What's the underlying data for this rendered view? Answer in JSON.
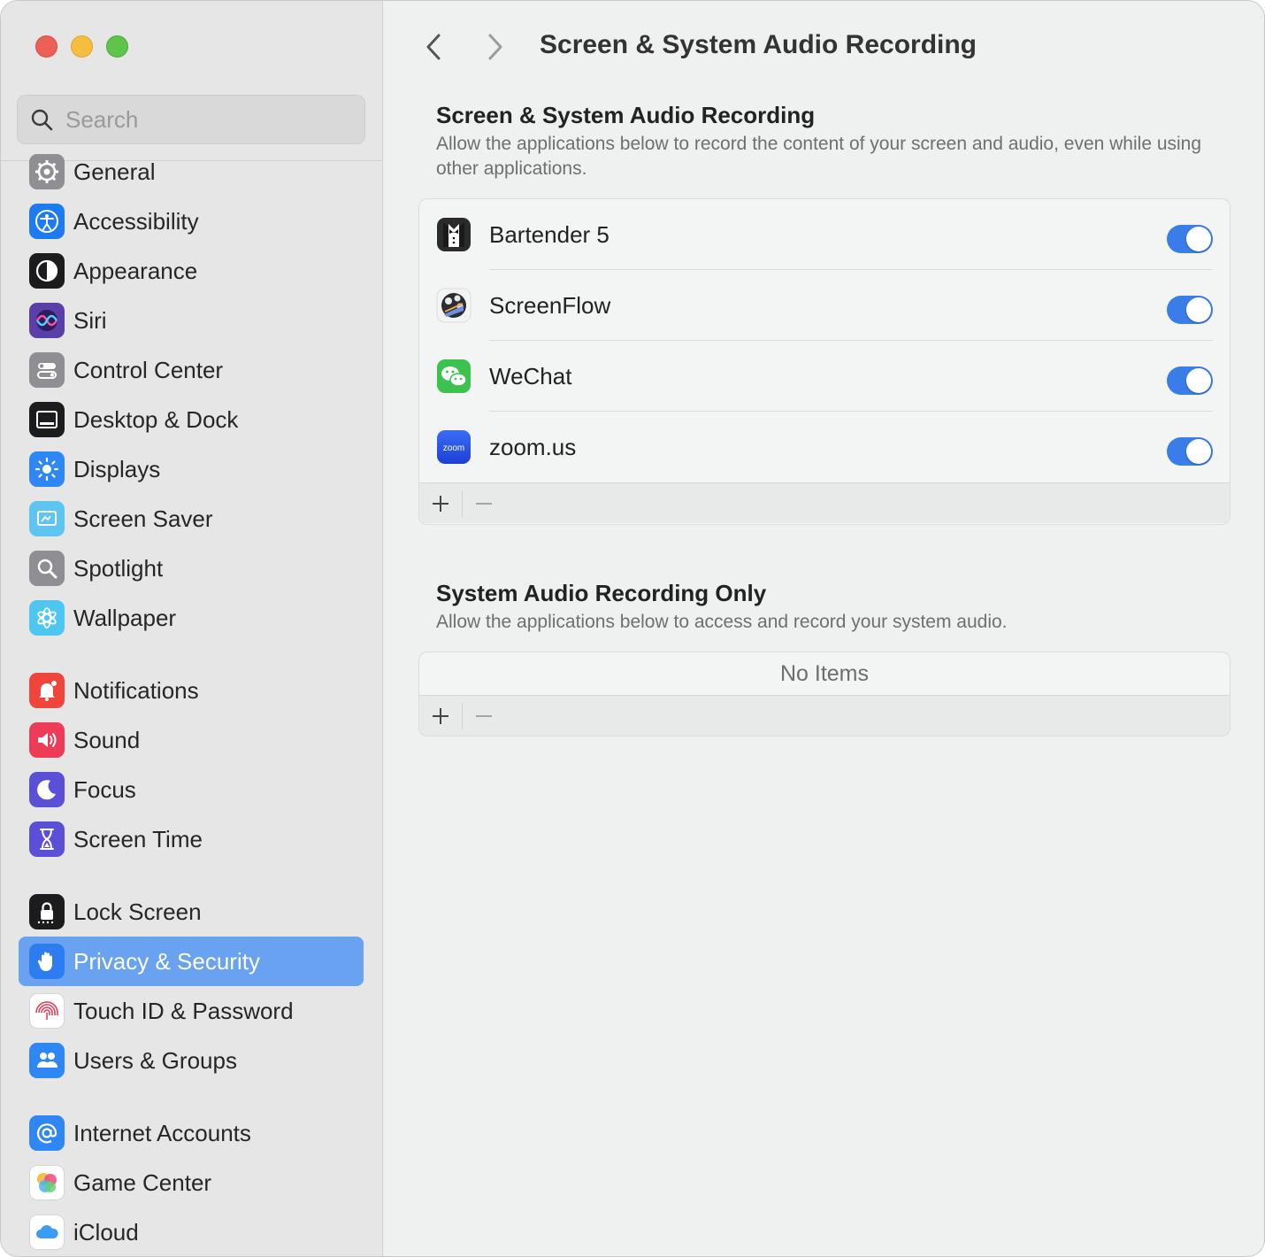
{
  "window": {
    "title": "Screen & System Audio Recording"
  },
  "sidebar": {
    "search_placeholder": "Search",
    "items": [
      {
        "label": "General",
        "icon": "gear-icon",
        "color": "#8e8e93"
      },
      {
        "label": "Accessibility",
        "icon": "accessibility-icon",
        "color": "#1d7af3"
      },
      {
        "label": "Appearance",
        "icon": "appearance-icon",
        "color": "#1c1c1e"
      },
      {
        "label": "Siri",
        "icon": "siri-icon",
        "color": "#5b3ea8"
      },
      {
        "label": "Control Center",
        "icon": "control-center-icon",
        "color": "#8e8e93"
      },
      {
        "label": "Desktop & Dock",
        "icon": "dock-icon",
        "color": "#1c1c1e"
      },
      {
        "label": "Displays",
        "icon": "sun-icon",
        "color": "#2f87f5"
      },
      {
        "label": "Screen Saver",
        "icon": "screen-saver-icon",
        "color": "#5ec4f0"
      },
      {
        "label": "Spotlight",
        "icon": "magnifier-icon",
        "color": "#8e8e93"
      },
      {
        "label": "Wallpaper",
        "icon": "flower-icon",
        "color": "#4ec6f2"
      },
      {
        "label": "Notifications",
        "icon": "bell-icon",
        "color": "#f0453a"
      },
      {
        "label": "Sound",
        "icon": "speaker-icon",
        "color": "#ee3b57"
      },
      {
        "label": "Focus",
        "icon": "moon-icon",
        "color": "#5a4fd6"
      },
      {
        "label": "Screen Time",
        "icon": "hourglass-icon",
        "color": "#5a4fd6"
      },
      {
        "label": "Lock Screen",
        "icon": "lock-icon",
        "color": "#1c1c1e"
      },
      {
        "label": "Privacy & Security",
        "icon": "hand-icon",
        "color": "#2d7cf0",
        "selected": true
      },
      {
        "label": "Touch ID & Password",
        "icon": "fingerprint-icon",
        "color": "#ffffff"
      },
      {
        "label": "Users & Groups",
        "icon": "users-icon",
        "color": "#2f87f5"
      },
      {
        "label": "Internet Accounts",
        "icon": "at-icon",
        "color": "#2f87f5"
      },
      {
        "label": "Game Center",
        "icon": "game-center-icon",
        "color": "#ffffff"
      },
      {
        "label": "iCloud",
        "icon": "cloud-icon",
        "color": "#ffffff"
      }
    ]
  },
  "screen_recording": {
    "title": "Screen & System Audio Recording",
    "description": "Allow the applications below to record the content of your screen and audio, even while using other applications.",
    "apps": [
      {
        "name": "Bartender 5",
        "icon": "bartender-icon",
        "enabled": true
      },
      {
        "name": "ScreenFlow",
        "icon": "screenflow-icon",
        "enabled": true
      },
      {
        "name": "WeChat",
        "icon": "wechat-icon",
        "enabled": true
      },
      {
        "name": "zoom.us",
        "icon": "zoom-icon",
        "icon_text": "zoom",
        "enabled": true
      }
    ],
    "add_label": "+",
    "remove_label": "−"
  },
  "audio_only": {
    "title": "System Audio Recording Only",
    "description": "Allow the applications below to access and record your system audio.",
    "empty_text": "No Items",
    "add_label": "+",
    "remove_label": "−"
  },
  "colors": {
    "accent": "#3a7de8",
    "selection": "#6aa2f2"
  }
}
